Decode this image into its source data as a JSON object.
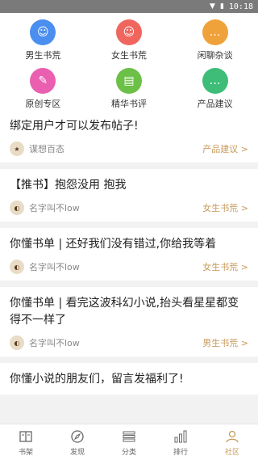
{
  "status": {
    "time": "10:18"
  },
  "categories": [
    {
      "label": "男生书荒",
      "icon": "male-face-icon",
      "color": "#4a8ef0",
      "glyph": "☺"
    },
    {
      "label": "女生书荒",
      "icon": "female-face-icon",
      "color": "#f0665f",
      "glyph": "☺"
    },
    {
      "label": "闲聊杂谈",
      "icon": "chat-bubble-icon",
      "color": "#f0a23a",
      "glyph": "…"
    },
    {
      "label": "原创专区",
      "icon": "pen-icon",
      "color": "#ea5fb0",
      "glyph": "✎"
    },
    {
      "label": "精华书评",
      "icon": "book-icon",
      "color": "#6cc047",
      "glyph": "▤"
    },
    {
      "label": "产品建议",
      "icon": "message-icon",
      "color": "#3dbd78",
      "glyph": "…"
    }
  ],
  "posts": [
    {
      "title": "绑定用户才可以发布帖子!",
      "author": "谋想百态",
      "tag": "产品建议 >"
    },
    {
      "title": "【推书】抱怨没用 抱我",
      "author": "名字叫不low",
      "tag": "女生书荒 >"
    },
    {
      "title": "你懂书单 | 还好我们没有错过,你给我等着",
      "author": "名字叫不low",
      "tag": "女生书荒 >"
    },
    {
      "title": "你懂书单 | 看完这波科幻小说,抬头看星星都变得不一样了",
      "author": "名字叫不low",
      "tag": "男生书荒 >"
    },
    {
      "title": "你懂小说的朋友们，留言发福利了!",
      "author": "",
      "tag": ""
    }
  ],
  "tabs": [
    {
      "label": "书架",
      "icon": "bookshelf-icon"
    },
    {
      "label": "发现",
      "icon": "compass-icon"
    },
    {
      "label": "分类",
      "icon": "list-icon"
    },
    {
      "label": "排行",
      "icon": "bar-chart-icon"
    },
    {
      "label": "社区",
      "icon": "person-icon",
      "active": true
    }
  ]
}
